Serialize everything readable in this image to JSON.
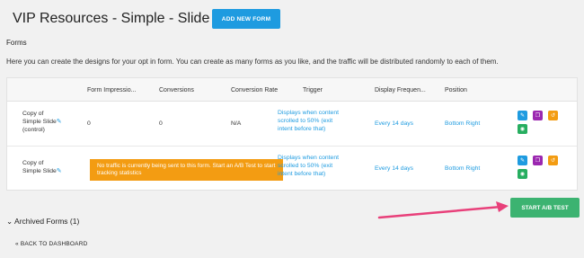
{
  "header": {
    "title": "VIP Resources - Simple - Slide in",
    "add_form_label": "ADD NEW FORM"
  },
  "forms_label": "Forms",
  "intro_text": "Here you can create the designs for your opt in form. You can create as many forms as you like, and the traffic will be distributed randomly to each of them.",
  "table": {
    "columns": [
      "Form Impressio...",
      "Conversions",
      "Conversion Rate",
      "Trigger",
      "Display Frequen...",
      "Position"
    ],
    "rows": [
      {
        "name_line1": "Copy of",
        "name_line2": "Simple Slide",
        "name_line3": "(control)",
        "impressions": "0",
        "conversions": "0",
        "rate": "N/A",
        "trigger": "Displays when content scrolled to 50% (exit intent before that)",
        "frequency": "Every 14 days",
        "position": "Bottom Right"
      },
      {
        "name_line1": "Copy of",
        "name_line2": "Simple Slide",
        "warning": "No traffic is currently being sent to this form. Start an A/B Test to start tracking statistics",
        "trigger": "Displays when content scrolled to 50% (exit intent before that)",
        "frequency": "Every 14 days",
        "position": "Bottom Right"
      }
    ]
  },
  "ab_test_label": "START A/B TEST",
  "archived_label": "Archived Forms (1)",
  "back_label": "« BACK TO DASHBOARD",
  "icons": {
    "pencil": "✎",
    "copy": "❐",
    "reset": "↺",
    "view": "◉",
    "chevron": "⌄"
  }
}
